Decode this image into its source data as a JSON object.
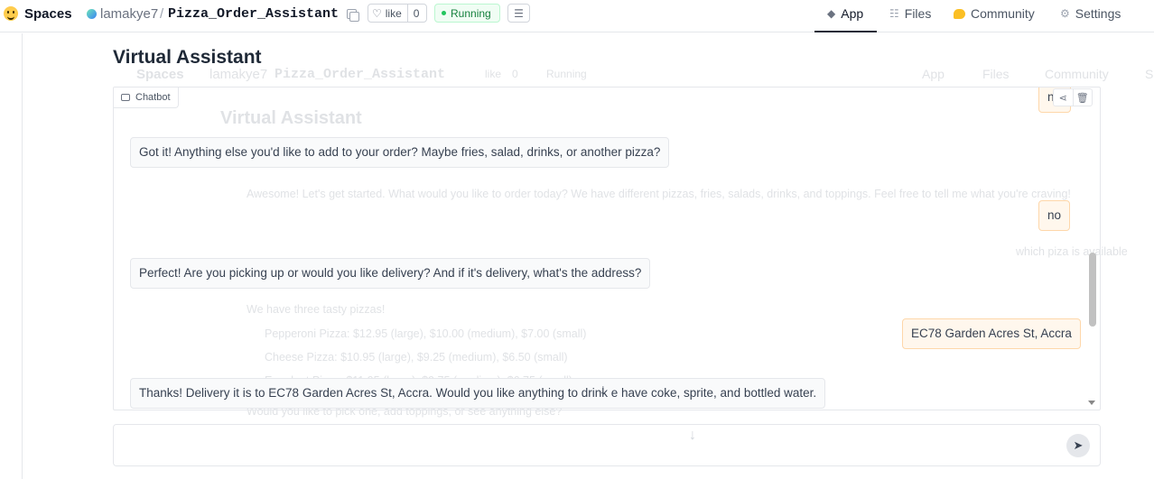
{
  "topbar": {
    "brand": "Spaces",
    "owner": "lamakye7",
    "slash": "/",
    "repo": "Pizza_Order_Assistant",
    "like_label": "like",
    "like_count": "0",
    "status": "Running",
    "tabs": [
      {
        "label": "App",
        "icon": "cube-icon"
      },
      {
        "label": "Files",
        "icon": "files-icon"
      },
      {
        "label": "Community",
        "icon": "community-icon"
      },
      {
        "label": "Settings",
        "icon": "gear-icon"
      }
    ]
  },
  "app": {
    "title": "Virtual Assistant",
    "chatbot_label": "Chatbot",
    "messages": [
      {
        "role": "user",
        "text": "no"
      },
      {
        "role": "bot",
        "text": "Got it! Anything else you'd like to add to your order? Maybe fries, salad, drinks, or another pizza?"
      },
      {
        "role": "user",
        "text": "no"
      },
      {
        "role": "bot",
        "text": "Perfect! Are you picking up or would you like delivery? And if it's delivery, what's the address?"
      },
      {
        "role": "user",
        "text": "EC78 Garden Acres St, Accra"
      },
      {
        "role": "bot",
        "text": "Thanks! Delivery it is to EC78 Garden Acres St, Accra. Would you like anything to drink e have coke, sprite, and bottled water."
      }
    ],
    "input_placeholder": ""
  },
  "ghost": {
    "brand": "Spaces",
    "owner": "lamakye7",
    "repo": "Pizza_Order_Assistant",
    "like_label": "like",
    "like_count": "0",
    "status": "Running",
    "tab_app": "App",
    "tab_files": "Files",
    "tab_community": "Community",
    "tab_settings": "Se",
    "title": "Virtual Assistant",
    "greeting": "Awesome! Let's get started. What would you like to order today? We have different pizzas, fries, salads, drinks, and toppings. Feel free to tell me what you're craving!",
    "question": "which piza is available",
    "list_intro": "We have three tasty pizzas!",
    "list_items": [
      "Pepperoni Pizza: $12.95 (large), $10.00 (medium), $7.00 (small)",
      "Cheese Pizza: $10.95 (large), $9.25 (medium), $6.50 (small)",
      "Eggplant Pizza: $11.95 (large), $9.75 (medium), $6.75 (small)"
    ],
    "followup": "Would you like to pick one, add toppings, or see anything else?"
  }
}
